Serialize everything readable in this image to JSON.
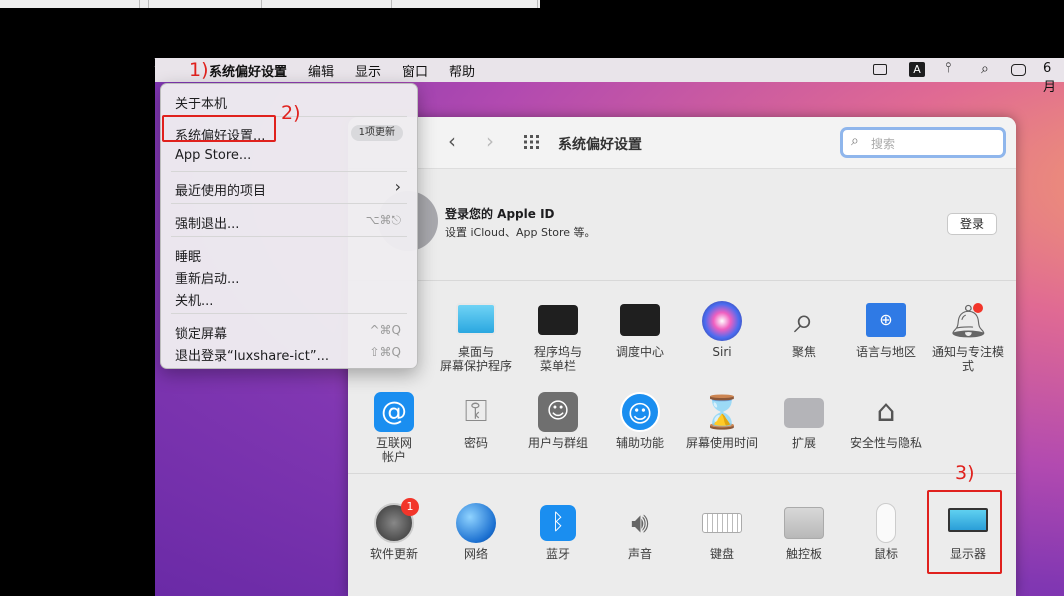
{
  "topstrip": {
    "tabs": [
      "",
      "",
      "",
      ""
    ]
  },
  "menubar": {
    "apple": "",
    "app": "系统偏好设置",
    "items": [
      "编辑",
      "显示",
      "窗口",
      "帮助"
    ],
    "input_badge": "A",
    "clock": "6月"
  },
  "annotations": {
    "a1": "1)",
    "a2": "2)",
    "a3": "3)"
  },
  "apple_menu": {
    "about": "关于本机",
    "sysprefs": "系统偏好设置...",
    "sysprefs_badge": "1项更新",
    "appstore": "App Store...",
    "recent": "最近使用的项目",
    "recent_arrow": "›",
    "force_quit": "强制退出...",
    "force_quit_sc": "⌥⌘⎋",
    "sleep": "睡眠",
    "restart": "重新启动...",
    "shutdown": "关机...",
    "lock": "锁定屏幕",
    "lock_sc": "^⌘Q",
    "logout": "退出登录“luxshare-ict”...",
    "logout_sc": "⇧⌘Q"
  },
  "window": {
    "title": "系统偏好设置",
    "search_placeholder": "搜索",
    "apple_id_title": "登录您的 Apple ID",
    "apple_id_sub": "设置 iCloud、App Store 等。",
    "login_btn": "登录"
  },
  "prefs": {
    "row1": [
      {
        "name": "desktop",
        "label": "桌面与\n屏幕保护程序"
      },
      {
        "name": "dock",
        "label": "程序坞与\n菜单栏"
      },
      {
        "name": "mission-control",
        "label": "调度中心"
      },
      {
        "name": "siri",
        "label": "Siri"
      },
      {
        "name": "spotlight",
        "label": "聚焦"
      },
      {
        "name": "language",
        "label": "语言与地区"
      },
      {
        "name": "notifications",
        "label": "通知与专注模式"
      }
    ],
    "row2": [
      {
        "name": "internet-accounts",
        "label": "互联网\n帐户"
      },
      {
        "name": "passwords",
        "label": "密码"
      },
      {
        "name": "users",
        "label": "用户与群组"
      },
      {
        "name": "accessibility",
        "label": "辅助功能"
      },
      {
        "name": "screen-time",
        "label": "屏幕使用时间"
      },
      {
        "name": "extensions",
        "label": "扩展"
      },
      {
        "name": "security",
        "label": "安全性与隐私"
      }
    ],
    "row3": [
      {
        "name": "software-update",
        "label": "软件更新",
        "badge": "1"
      },
      {
        "name": "network",
        "label": "网络"
      },
      {
        "name": "bluetooth",
        "label": "蓝牙"
      },
      {
        "name": "sound",
        "label": "声音"
      },
      {
        "name": "keyboard",
        "label": "键盘"
      },
      {
        "name": "trackpad",
        "label": "触控板"
      },
      {
        "name": "mouse",
        "label": "鼠标"
      },
      {
        "name": "displays",
        "label": "显示器"
      }
    ]
  }
}
